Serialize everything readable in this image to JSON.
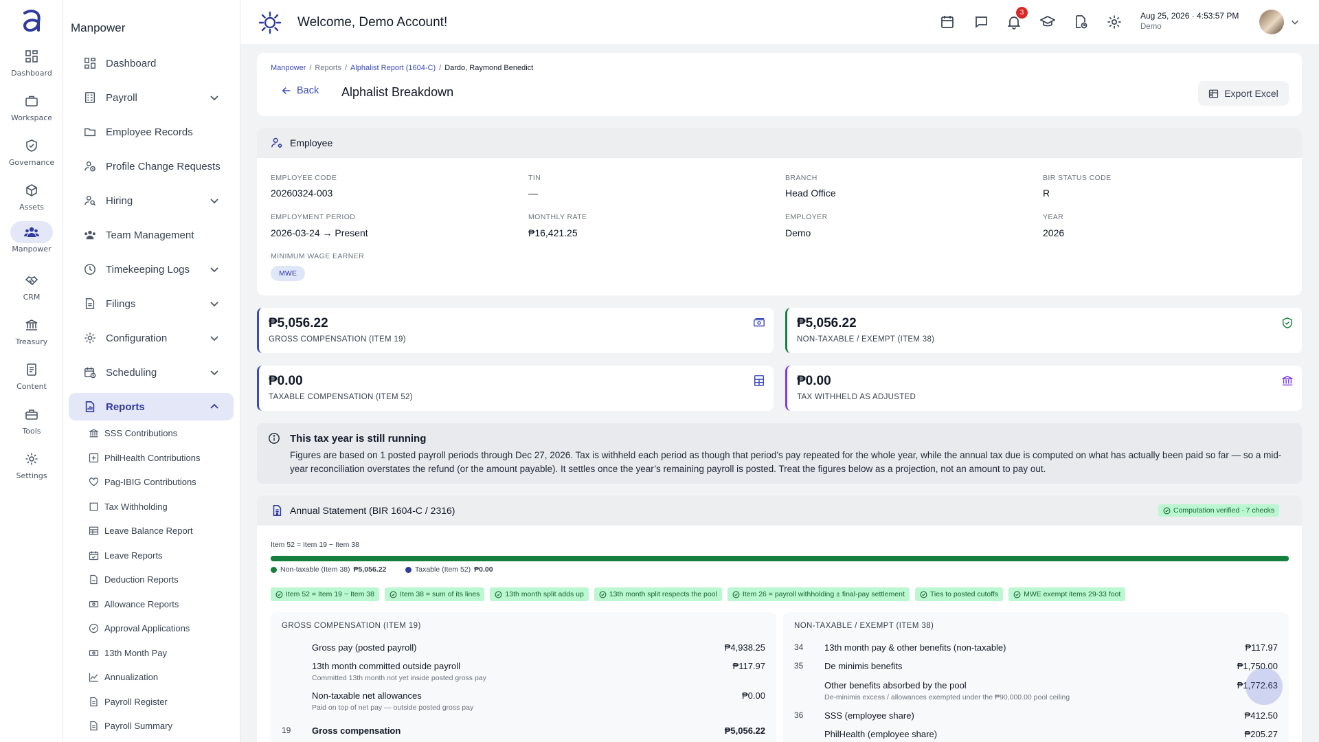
{
  "rail": {
    "items": [
      {
        "label": "Dashboard",
        "icon": "grid-icon"
      },
      {
        "label": "Workspace",
        "icon": "briefcase-icon"
      },
      {
        "label": "Governance",
        "icon": "shield-check-icon"
      },
      {
        "label": "Assets",
        "icon": "cube-icon"
      },
      {
        "label": "Manpower",
        "icon": "people-icon",
        "active": true
      },
      {
        "label": "CRM",
        "icon": "handshake-icon"
      },
      {
        "label": "Treasury",
        "icon": "bank-icon"
      },
      {
        "label": "Content",
        "icon": "document-icon"
      },
      {
        "label": "Tools",
        "icon": "toolbox-icon"
      },
      {
        "label": "Settings",
        "icon": "gear-icon"
      }
    ]
  },
  "sidenav": {
    "title": "Manpower",
    "items": [
      {
        "label": "Dashboard"
      },
      {
        "label": "Payroll"
      },
      {
        "label": "Employee Records"
      },
      {
        "label": "Profile Change Requests"
      },
      {
        "label": "Hiring"
      },
      {
        "label": "Team Management"
      },
      {
        "label": "Timekeeping Logs"
      },
      {
        "label": "Filings"
      },
      {
        "label": "Configuration"
      },
      {
        "label": "Scheduling"
      },
      {
        "label": "Reports"
      }
    ],
    "report_items": [
      {
        "label": "SSS Contributions"
      },
      {
        "label": "PhilHealth Contributions"
      },
      {
        "label": "Pag-IBIG Contributions"
      },
      {
        "label": "Tax Withholding"
      },
      {
        "label": "Leave Balance Report"
      },
      {
        "label": "Leave Reports"
      },
      {
        "label": "Deduction Reports"
      },
      {
        "label": "Allowance Reports"
      },
      {
        "label": "Approval Applications"
      },
      {
        "label": "13th Month Pay"
      },
      {
        "label": "Annualization"
      },
      {
        "label": "Payroll Register"
      },
      {
        "label": "Payroll Summary"
      }
    ]
  },
  "topbar": {
    "welcome": "Welcome, Demo Account!",
    "notification_count": "3",
    "datetime": "Aug 25, 2026 · 4:53:57 PM",
    "org": "Demo"
  },
  "breadcrumb": {
    "c1": "Manpower",
    "c2": "Reports",
    "c3": "Alphalist Report (1604-C)",
    "c4": "Dardo, Raymond Benedict",
    "sep": "/"
  },
  "header": {
    "back": "Back",
    "title": "Alphalist Breakdown",
    "export": "Export Excel"
  },
  "employee": {
    "section_title": "Employee",
    "fields": {
      "code_label": "EMPLOYEE CODE",
      "code": "20260324-003",
      "tin_label": "TIN",
      "tin": "—",
      "branch_label": "BRANCH",
      "branch": "Head Office",
      "bir_label": "BIR STATUS CODE",
      "bir": "R",
      "period_label": "EMPLOYMENT PERIOD",
      "period": "2026-03-24 → Present",
      "rate_label": "MONTHLY RATE",
      "rate": "₱16,421.25",
      "employer_label": "EMPLOYER",
      "employer": "Demo",
      "year_label": "YEAR",
      "year": "2026",
      "mwe_label": "MINIMUM WAGE EARNER",
      "mwe": "MWE"
    }
  },
  "kpis": [
    {
      "value": "₱5,056.22",
      "label": "GROSS COMPENSATION (ITEM 19)",
      "icon": "cash-icon",
      "color": "#3b4ab8"
    },
    {
      "value": "₱5,056.22",
      "label": "NON-TAXABLE / EXEMPT (ITEM 38)",
      "icon": "shield-check-icon",
      "color": "#15803d"
    },
    {
      "value": "₱0.00",
      "label": "TAXABLE COMPENSATION (ITEM 52)",
      "icon": "calculator-icon",
      "color": "#3b4ab8"
    },
    {
      "value": "₱0.00",
      "label": "TAX WITHHELD AS ADJUSTED",
      "icon": "bank-icon",
      "color": "#7c3aed"
    }
  ],
  "notice": {
    "title": "This tax year is still running",
    "body": "Figures are based on 1 posted payroll periods through Dec 27, 2026. Tax is withheld each period as though that period’s pay repeated for the whole year, while the annual tax due is computed on what has actually been paid so far — so a mid-year reconciliation overstates the refund (or the amount payable). It settles once the year’s remaining payroll is posted. Treat the figures below as a projection, not an amount to pay out."
  },
  "statement": {
    "title": "Annual Statement (BIR 1604-C / 2316)",
    "verified": "Computation verified · 7 checks",
    "formula": "Item 52 = Item 19 − Item 38",
    "split": {
      "nontaxable_fraction": 1.0,
      "taxable_fraction": 0.0
    },
    "legend_nontax": "Non-taxable (Item 38)",
    "legend_nontax_value": "₱5,056.22",
    "legend_tax": "Taxable (Item 52)",
    "legend_tax_value": "₱0.00",
    "checks": [
      "Item 52 = Item 19 − Item 38",
      "Item 38 = sum of its lines",
      "13th month split adds up",
      "13th month split respects the pool",
      "Item 26 = payroll withholding ± final-pay settlement",
      "Ties to posted cutoffs",
      "MWE exempt items 29-33 foot"
    ],
    "gross": {
      "title": "GROSS COMPENSATION (ITEM 19)",
      "rows": [
        {
          "num": "",
          "desc": "Gross pay (posted payroll)",
          "sub": "",
          "amount": "₱4,938.25"
        },
        {
          "num": "",
          "desc": "13th month committed outside payroll",
          "sub": "Committed 13th month not yet inside posted gross pay",
          "amount": "₱117.97"
        },
        {
          "num": "",
          "desc": "Non-taxable net allowances",
          "sub": "Paid on top of net pay — outside posted gross pay",
          "amount": "₱0.00"
        },
        {
          "num": "19",
          "desc": "Gross compensation",
          "sub": "",
          "amount": "₱5,056.22"
        }
      ]
    },
    "nontax": {
      "title": "NON-TAXABLE / EXEMPT (ITEM 38)",
      "rows": [
        {
          "num": "34",
          "desc": "13th month pay & other benefits (non-taxable)",
          "sub": "",
          "amount": "₱117.97"
        },
        {
          "num": "35",
          "desc": "De minimis benefits",
          "sub": "",
          "amount": "₱1,750.00"
        },
        {
          "num": "",
          "desc": "Other benefits absorbed by the pool",
          "sub": "De-minimis excess / allowances exempted under the ₱90,000.00 pool ceiling",
          "amount": "₱1,772.63"
        },
        {
          "num": "36",
          "desc": "SSS (employee share)",
          "sub": "",
          "amount": "₱412.50"
        },
        {
          "num": "",
          "desc": "PhilHealth (employee share)",
          "sub": "",
          "amount": "₱205.27"
        }
      ]
    }
  }
}
